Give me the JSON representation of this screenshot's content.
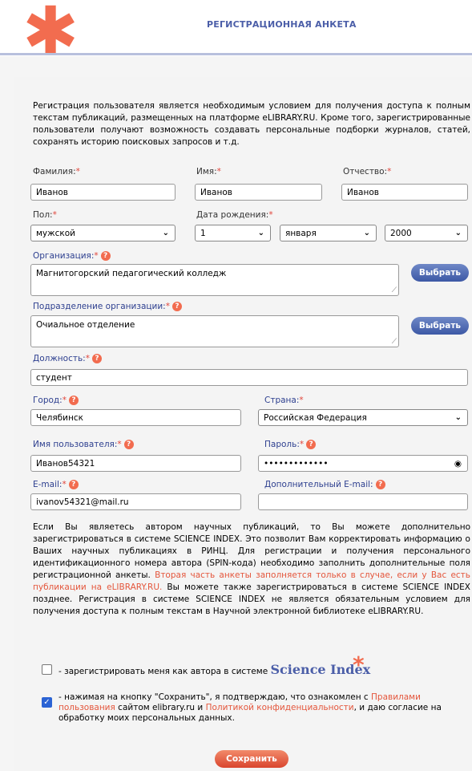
{
  "header": {
    "title": "РЕГИСТРАЦИОННАЯ АНКЕТА"
  },
  "intro": "Регистрация пользователя является необходимым условием для получения доступа к полным текстам публикаций, размещенных на платформе eLIBRARY.RU. Кроме того, зарегистрированные пользователи получают возможность создавать персональные подборки журналов, статей, сохранять историю поисковых запросов и т.д.",
  "fields": {
    "lastname": {
      "label": "Фамилия:",
      "value": "Иванов"
    },
    "firstname": {
      "label": "Имя:",
      "value": "Иванов"
    },
    "middlename": {
      "label": "Отчество:",
      "value": "Иванов"
    },
    "gender": {
      "label": "Пол:",
      "value": "мужской"
    },
    "birthdate": {
      "label": "Дата рождения:",
      "day": "1",
      "month": "января",
      "year": "2000"
    },
    "organization": {
      "label": "Организация:",
      "value": "Магнитогорский педагогический колледж",
      "button": "Выбрать"
    },
    "department": {
      "label": "Подразделение организации:",
      "value": "Очиальное отделение",
      "button": "Выбрать"
    },
    "position": {
      "label": "Должность:",
      "value": "студент"
    },
    "city": {
      "label": "Город:",
      "value": "Челябинск"
    },
    "country": {
      "label": "Страна:",
      "value": "Российская Федерация"
    },
    "username": {
      "label": "Имя пользователя:",
      "value": "Иванов54321"
    },
    "password": {
      "label": "Пароль:",
      "value": "•••••••••••••"
    },
    "email": {
      "label": "E-mail:",
      "value": "ivanov54321@mail.ru"
    },
    "email2": {
      "label": "Дополнительный E-mail:",
      "value": ""
    }
  },
  "required_mark": "*",
  "help_glyph": "?",
  "author_text": {
    "part1": "Если Вы являетесь автором научных публикаций, то Вы можете дополнительно зарегистрироваться в системе SCIENCE INDEX. Это позволит Вам корректировать информацию о Ваших научных публикациях в РИНЦ. Для регистрации и получения персонального идентификационного номера автора (SPIN-кода) необходимо заполнить дополнительные поля регистрационной анкеты. ",
    "part2_red": "Вторая часть анкеты заполняется только в случае, если у Вас есть публикации на eLIBRARY.RU.",
    "part3": " Вы можете также зарегистрироваться в системе SCIENCE INDEX позднее. Регистрация в системе SCIENCE INDEX не является обязательным условием для получения доступа к полным текстам в Научной электронной библиотеке eLIBRARY.RU."
  },
  "author_checkbox": {
    "text": "- зарегистрировать меня как автора в системе",
    "brand": "Science Index",
    "checked": false
  },
  "consent": {
    "checked": true,
    "t1": "- нажимая на кнопку \"Сохранить\", я подтверждаю, что ознакомлен с ",
    "link1": "Правилами пользования",
    "t2": " сайтом elibrary.ru и ",
    "link2": "Политикой конфиденциальности",
    "t3": ", и даю согласие на обработку моих персональных данных."
  },
  "save_button": "Сохранить",
  "colors": {
    "accent": "#f26c4f",
    "brand_blue": "#4b5ea8",
    "button_blue": "#3c58a5",
    "checkbox_blue": "#2b63d4"
  }
}
